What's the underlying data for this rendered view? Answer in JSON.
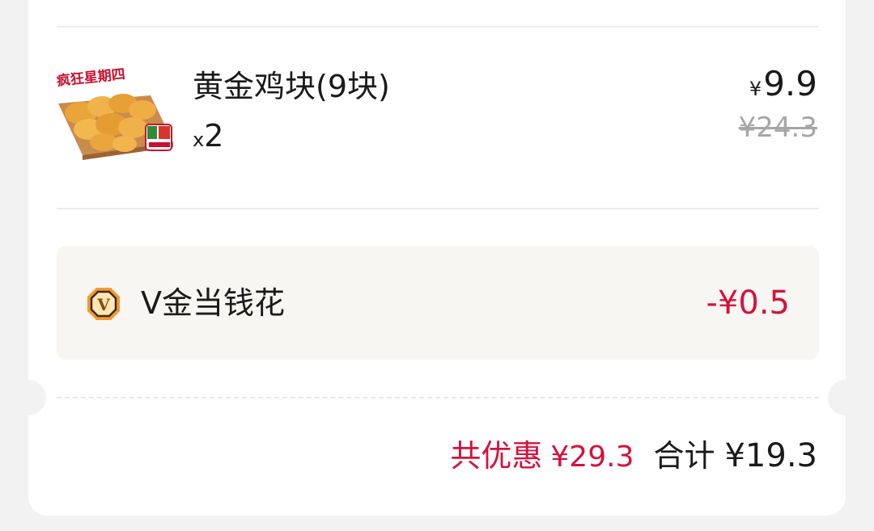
{
  "product": {
    "image_banner_text": "疯狂星期四",
    "name": "黄金鸡块(9块)",
    "qty_prefix": "x",
    "qty": "2",
    "price_currency": "¥",
    "price": "9.9",
    "original_price": "¥24.3"
  },
  "vgold": {
    "icon": "v-coin-icon",
    "label": "V金当钱花",
    "amount": "-¥0.5"
  },
  "summary": {
    "discount_label": "共优惠",
    "discount_value": "¥29.3",
    "total_label": "合计",
    "total_value": "¥19.3"
  },
  "colors": {
    "accent_red": "#d3123d",
    "coin_orange": "#f29a2e"
  }
}
